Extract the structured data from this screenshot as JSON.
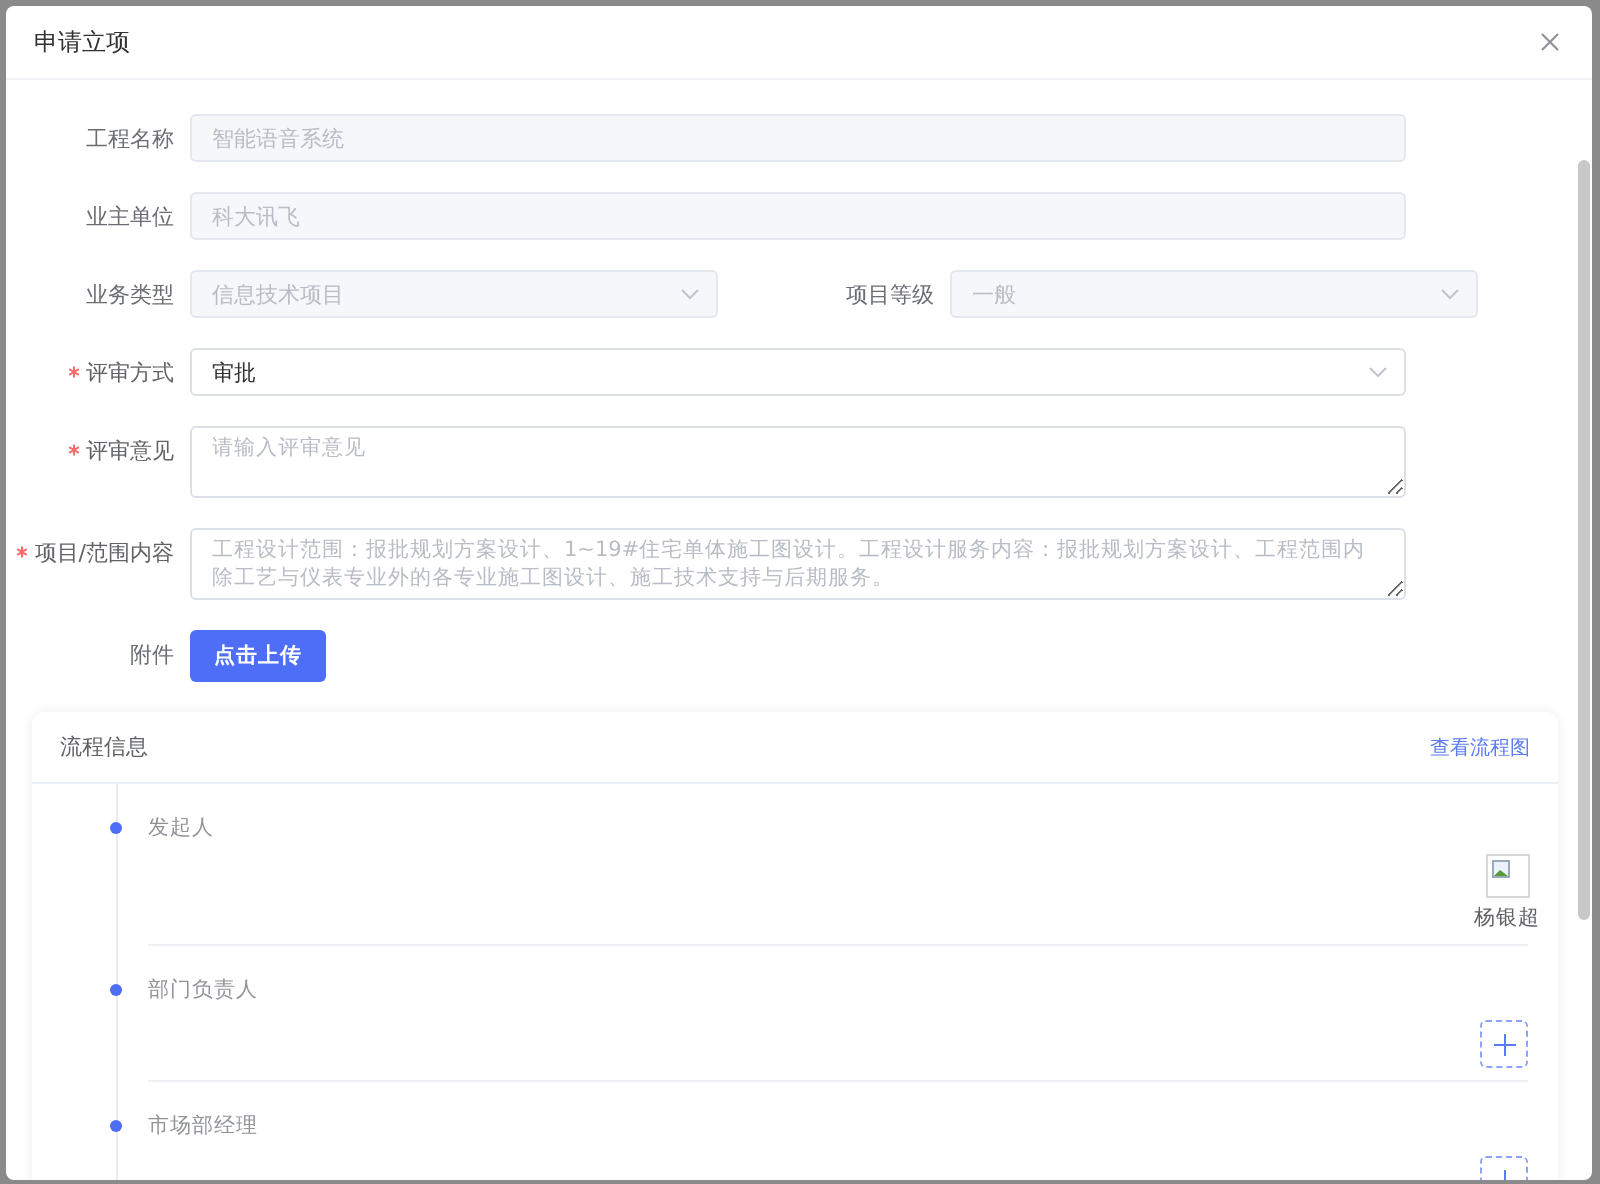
{
  "dialog": {
    "title": "申请立项"
  },
  "form": {
    "rows": [
      {
        "fields": [
          {
            "kind": "input",
            "label": "工程名称",
            "value": "智能语音系统",
            "disabled": true,
            "required": false
          }
        ]
      },
      {
        "fields": [
          {
            "kind": "input",
            "label": "业主单位",
            "value": "科大讯飞",
            "disabled": true,
            "required": false
          }
        ]
      },
      {
        "fields": [
          {
            "kind": "select",
            "label": "业务类型",
            "value": "信息技术项目",
            "disabled": true,
            "required": false
          },
          {
            "kind": "select",
            "label": "项目等级",
            "value": "一般",
            "disabled": true,
            "required": false
          }
        ]
      },
      {
        "fields": [
          {
            "kind": "select",
            "label": "评审方式",
            "value": "审批",
            "disabled": false,
            "required": true
          }
        ]
      },
      {
        "fields": [
          {
            "kind": "textarea",
            "label": "评审意见",
            "placeholder": "请输入评审意见",
            "required": true
          }
        ]
      },
      {
        "fields": [
          {
            "kind": "textarea",
            "label": "项目/范围内容",
            "placeholder": "工程设计范围：报批规划方案设计、1~19#住宅单体施工图设计。工程设计服务内容：报批规划方案设计、工程范围内除工艺与仪表专业外的各专业施工图设计、施工技术支持与后期服务。",
            "required": true
          }
        ]
      },
      {
        "fields": [
          {
            "kind": "upload",
            "label": "附件",
            "button": "点击上传",
            "required": false
          }
        ]
      }
    ]
  },
  "process": {
    "title": "流程信息",
    "link": "查看流程图",
    "steps": [
      {
        "label": "发起人",
        "kind": "assigned",
        "approver": "杨银超"
      },
      {
        "label": "部门负责人",
        "kind": "open"
      },
      {
        "label": "市场部经理",
        "kind": "open"
      }
    ]
  }
}
